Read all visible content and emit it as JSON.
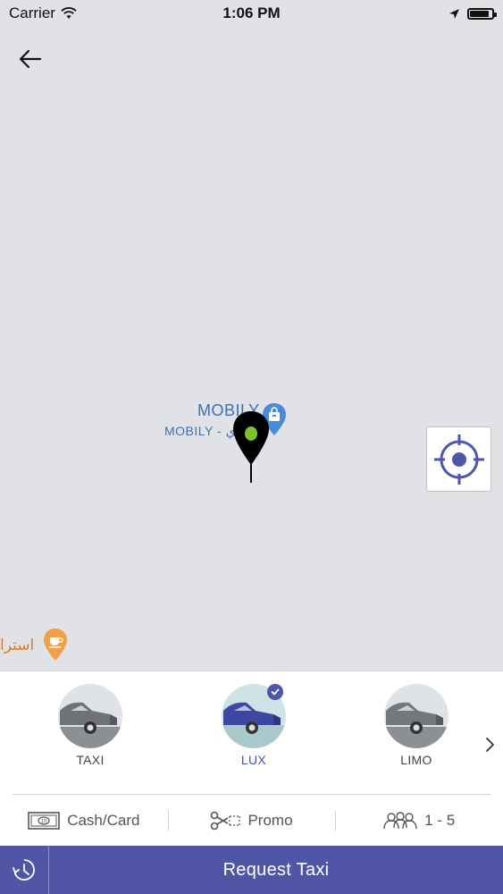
{
  "status_bar": {
    "carrier": "Carrier",
    "time": "1:06 PM",
    "battery_level": 0.9
  },
  "map": {
    "poi_mobily_1": "MOBILY",
    "poi_mobily_2": "MOBILY - ي",
    "poi_arabic": "استرا",
    "colors": {
      "pin_body": "#000000",
      "pin_center": "#7cc12e",
      "poi_blue": "#4a8ad8",
      "poi_orange": "#f0a04b",
      "locate_icon": "#4f57a8"
    }
  },
  "car_types": [
    {
      "label": "TAXI",
      "selected": false
    },
    {
      "label": "LUX",
      "selected": true
    },
    {
      "label": "LIMO",
      "selected": false
    }
  ],
  "options": {
    "payment": "Cash/Card",
    "promo": "Promo",
    "passengers": "1 - 5"
  },
  "bottom_bar": {
    "request_label": "Request Taxi",
    "color": "#5155a5"
  }
}
